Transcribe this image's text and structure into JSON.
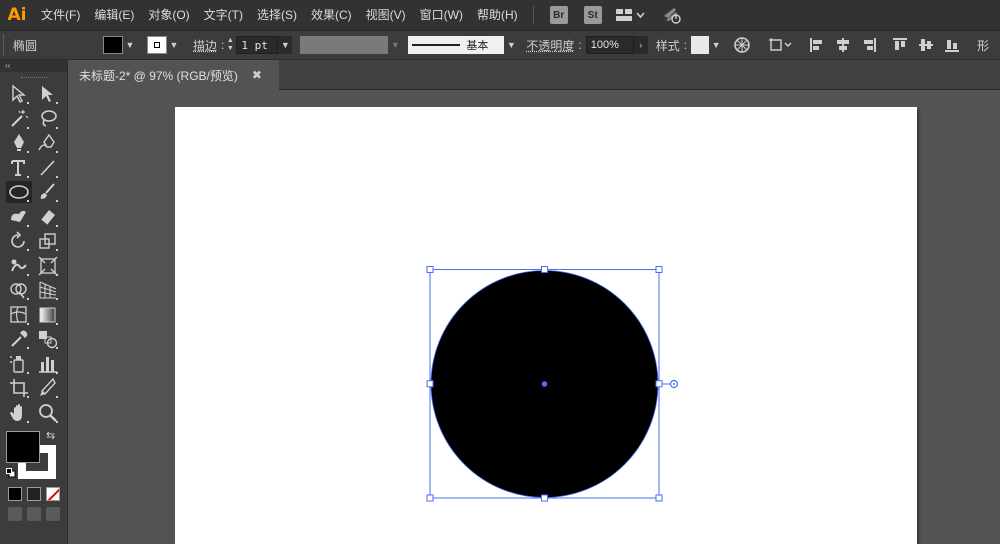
{
  "app": {
    "logo": "Ai",
    "accent": "#ff9a00"
  },
  "menu": {
    "items": [
      "文件(F)",
      "编辑(E)",
      "对象(O)",
      "文字(T)",
      "选择(S)",
      "效果(C)",
      "视图(V)",
      "窗口(W)",
      "帮助(H)"
    ],
    "bridge": "Br",
    "stock": "St",
    "workspace_icon": "workspace-layout-icon",
    "gpu_icon": "gpu-performance-icon"
  },
  "control_bar": {
    "selection_label": "椭圆",
    "fill_color": "#000000",
    "stroke_color": "#ffffff",
    "stroke_label": "描边",
    "stroke_weight": "1 pt",
    "brush_label": "基本",
    "opacity_label": "不透明度",
    "opacity_value": "100%",
    "style_label": "样式",
    "trailing_label": "形"
  },
  "tool_panel": {
    "collapse_glyph": "‹‹",
    "tools": [
      [
        "selection-tool-icon",
        "direct-selection-tool-icon"
      ],
      [
        "magic-wand-tool-icon",
        "lasso-tool-icon"
      ],
      [
        "pen-tool-icon",
        "curvature-tool-icon"
      ],
      [
        "type-tool-icon",
        "line-segment-tool-icon"
      ],
      [
        "ellipse-tool-icon",
        "paintbrush-tool-icon"
      ],
      [
        "shaper-tool-icon",
        "eraser-tool-icon"
      ],
      [
        "rotate-tool-icon",
        "scale-tool-icon"
      ],
      [
        "warp-tool-icon",
        "free-transform-tool-icon"
      ],
      [
        "shape-builder-tool-icon",
        "perspective-grid-tool-icon"
      ],
      [
        "mesh-tool-icon",
        "gradient-tool-icon"
      ],
      [
        "eyedropper-tool-icon",
        "blend-tool-icon"
      ],
      [
        "symbol-sprayer-tool-icon",
        "column-graph-tool-icon"
      ],
      [
        "artboard-tool-icon",
        "slice-tool-icon"
      ],
      [
        "hand-tool-icon",
        "zoom-tool-icon"
      ]
    ],
    "active_tool": "ellipse-tool-icon",
    "fill_color": "#000000",
    "stroke_color": "#ffffff"
  },
  "document": {
    "tab_title": "未标题-2* @ 97% (RGB/预览)",
    "close_glyph": "✖"
  },
  "artwork": {
    "shape": "ellipse",
    "fill": "#000000",
    "selection_color": "#4a6cf7"
  }
}
